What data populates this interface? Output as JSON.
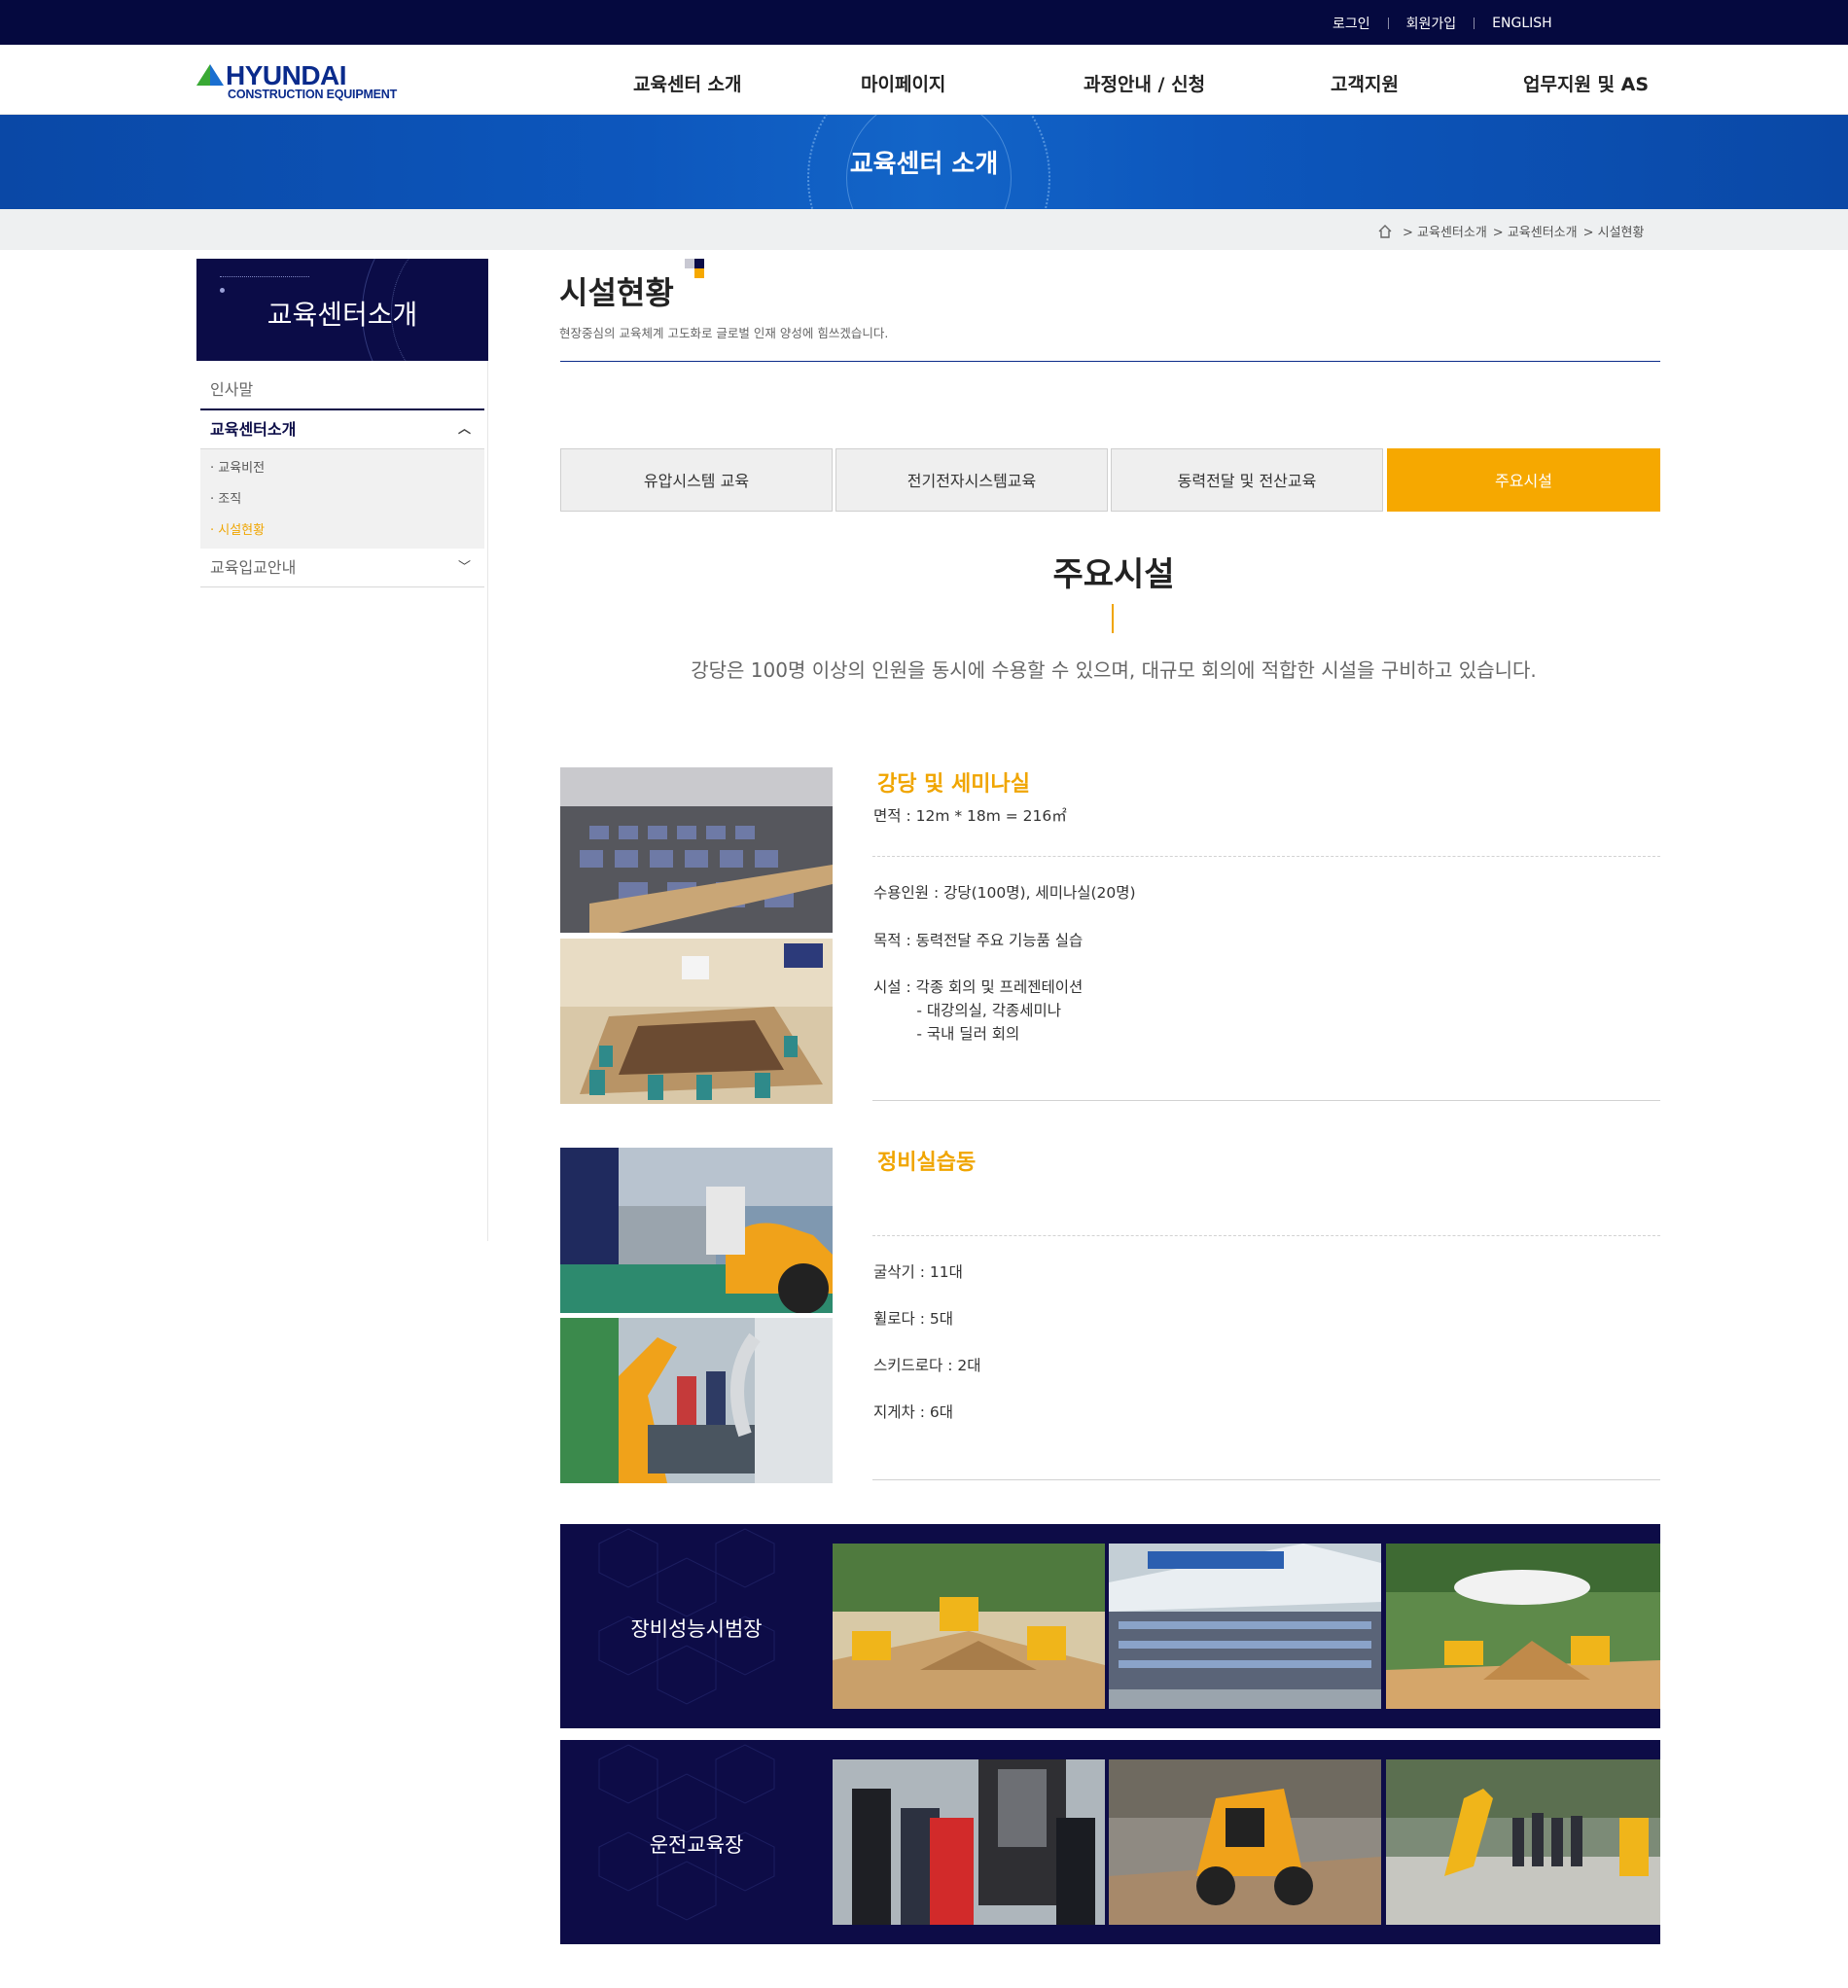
{
  "util_links": [
    "로그인",
    "회원가입",
    "ENGLISH"
  ],
  "logo": {
    "brand": "HYUNDAI",
    "sub": "CONSTRUCTION EQUIPMENT"
  },
  "gnb": [
    "교육센터 소개",
    "마이페이지",
    "과정안내 / 신청",
    "고객지원",
    "업무지원 및 AS"
  ],
  "banner_title": "교육센터 소개",
  "breadcrumb": [
    "> 교육센터소개",
    "> 교육센터소개",
    "> 시설현황"
  ],
  "lnb": {
    "title": "교육센터소개",
    "items": [
      "인사말",
      "교육센터소개",
      "교육입교안내"
    ],
    "sub_items": [
      "· 교육비전",
      "· 조직",
      "· 시설현황"
    ]
  },
  "page": {
    "title": "시설현황",
    "desc": "현장중심의 교육체계 고도화로 글로벌 인재 양성에 힘쓰겠습니다."
  },
  "tabs": [
    "유압시스템 교육",
    "전기전자시스템교육",
    "동력전달 및 전산교육",
    "주요시설"
  ],
  "section": {
    "title": "주요시설",
    "desc": "강당은 100명 이상의 인원을 동시에 수용할 수 있으며, 대규모 회의에 적합한 시설을 구비하고 있습니다."
  },
  "facilities": [
    {
      "title": "강당 및 세미나실",
      "area": "면적 : 12m * 18m = 216㎡",
      "capacity": "수용인원 : 강당(100명), 세미나실(20명)",
      "purpose": "목적 : 동력전달 주요 기능품 실습",
      "facility": "시설 : 각종 회의 및 프레젠테이션\n         - 대강의실, 각종세미나\n         - 국내 딜러 회의"
    },
    {
      "title": "정비실습동",
      "items": [
        "굴삭기 : 11대",
        "휠로다 : 5대",
        "스키드로다 : 2대",
        "지게차 : 6대"
      ]
    }
  ],
  "strips": [
    "장비성능시범장",
    "운전교육장"
  ],
  "colors": {
    "navy": "#05093f",
    "accent": "#f6a800",
    "blue": "#0d57bd"
  }
}
